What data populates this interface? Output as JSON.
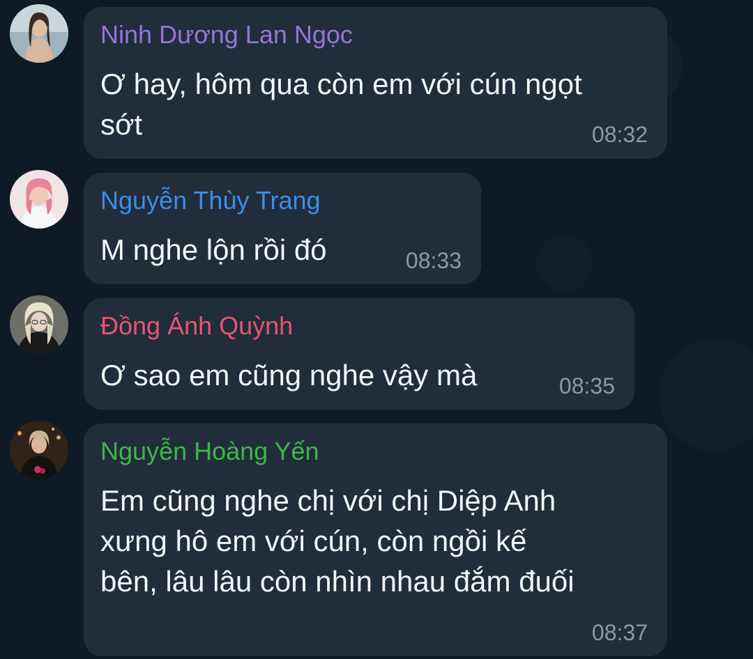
{
  "messages": [
    {
      "sender": "Ninh Dương Lan Ngọc",
      "sender_color": "#9775d6",
      "text": "Ơ hay, hôm qua còn em với cún ngọt\nsớt",
      "time": "08:32",
      "avatar_icon": "user-photo-icon"
    },
    {
      "sender": "Nguyễn Thùy Trang",
      "sender_color": "#3d8de8",
      "text": "M nghe lộn rồi đó",
      "time": "08:33",
      "avatar_icon": "user-photo-icon"
    },
    {
      "sender": "Đồng Ánh Quỳnh",
      "sender_color": "#e8566e",
      "text": "Ơ sao em cũng nghe vậy mà",
      "time": "08:35",
      "avatar_icon": "user-photo-icon"
    },
    {
      "sender": "Nguyễn Hoàng Yến",
      "sender_color": "#3fb54a",
      "text": "Em cũng nghe chị với chị Diệp Anh\nxưng hô em với cún, còn ngồi kế\nbên, lâu lâu còn nhìn nhau đắm đuối",
      "time": "08:37",
      "avatar_icon": "user-photo-icon"
    }
  ],
  "colors": {
    "background": "#0e1621",
    "bubble": "#212d3b",
    "message_text": "#f3f5f7",
    "timestamp": "#8b99a8"
  }
}
